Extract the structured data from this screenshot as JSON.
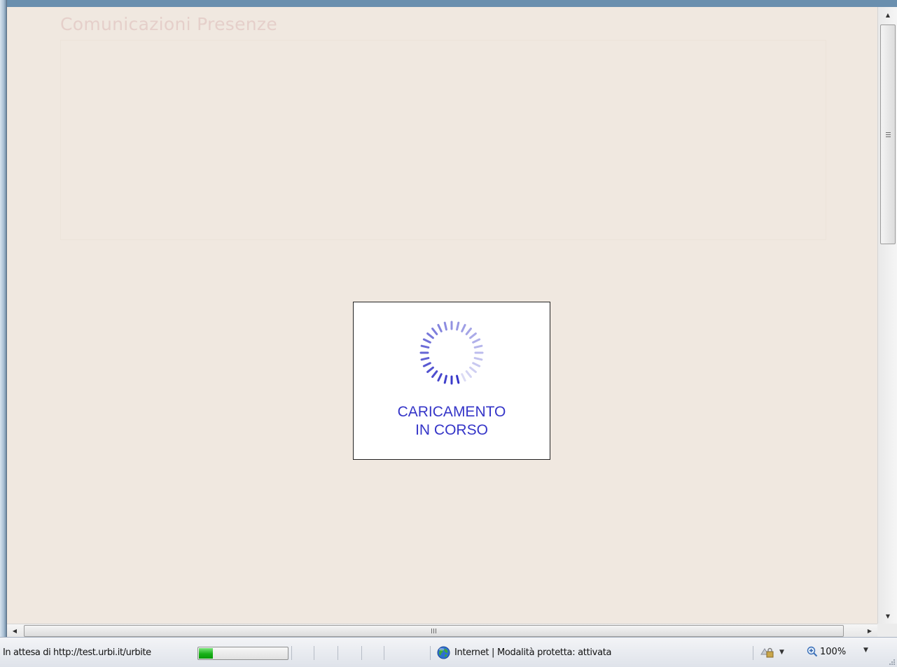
{
  "page": {
    "title": "Comunicazioni Presenze"
  },
  "loading": {
    "line1": "CARICAMENTO",
    "line2": "IN CORSO",
    "color": "#3535c8",
    "spinner_icon": "spinner-icon"
  },
  "statusbar": {
    "status_text": "In attesa di http://test.urbi.it/urbite",
    "progress_fraction": 0.16,
    "zone_text": "Internet | Modalità protetta: attivata",
    "zone_icon": "globe-icon",
    "security_icon": "lock-icon",
    "zoom_label": "100%",
    "zoom_icon": "zoom-icon"
  },
  "colors": {
    "background": "#f0e8e0",
    "title": "#e5cfca",
    "progress_green": "#18b018"
  }
}
